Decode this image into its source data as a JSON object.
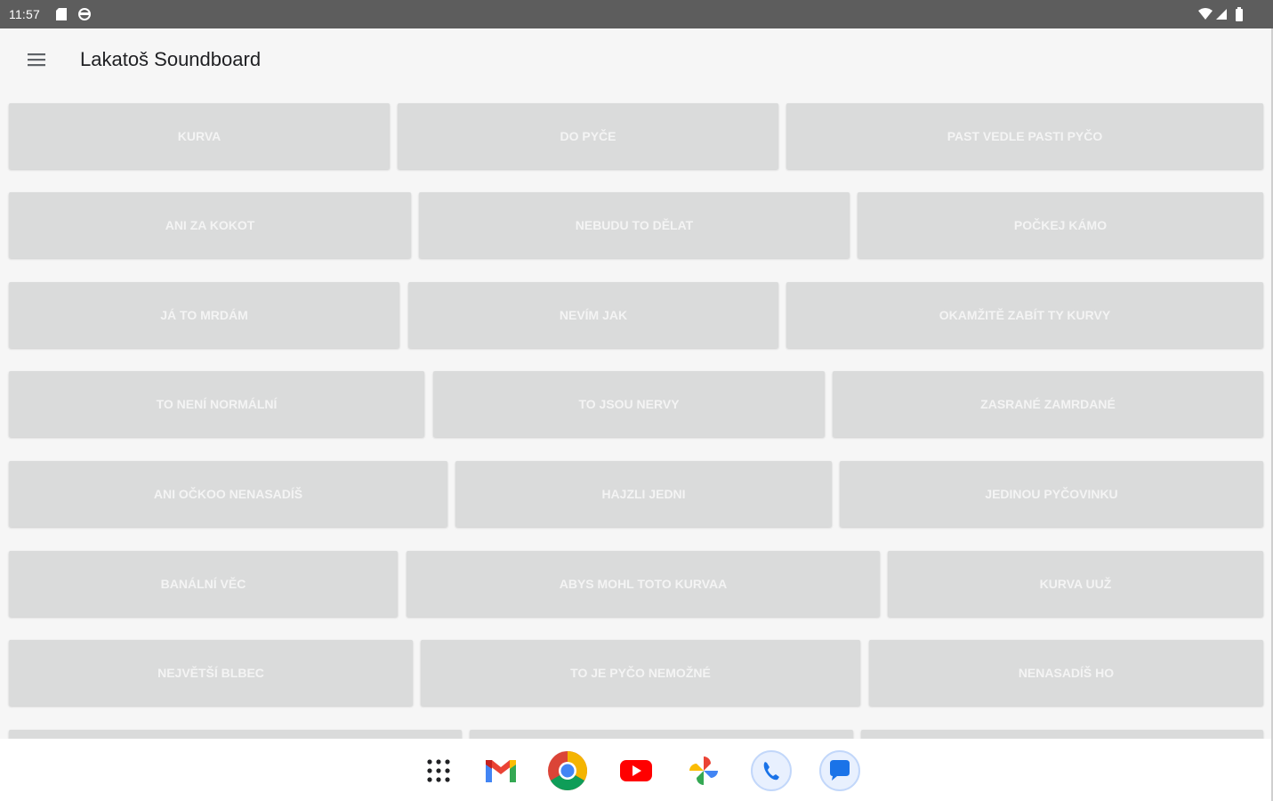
{
  "status_bar": {
    "time": "11:57",
    "left_icons": [
      "sd-card-icon",
      "sync-icon"
    ],
    "right_icons": [
      "wifi-icon",
      "signal-icon",
      "battery-icon"
    ]
  },
  "app_bar": {
    "title": "Lakatoš Soundboard",
    "menu_icon": "menu-icon"
  },
  "sound_rows": [
    [
      "KURVA",
      "DO PYČE",
      "PAST VEDLE PASTI PYČO"
    ],
    [
      "ANI ZA KOKOT",
      "NEBUDU TO DĚLAT",
      "POČKEJ KÁMO"
    ],
    [
      "JÁ TO MRDÁM",
      "NEVÍM JAK",
      "OKAMŽITĚ ZABÍT TY KURVY"
    ],
    [
      "TO NENÍ NORMÁLNÍ",
      "TO JSOU NERVY",
      "ZASRANÉ ZAMRDANÉ"
    ],
    [
      "ANI OČKOO NENASADÍŠ",
      "HAJZLI JEDNI",
      "JEDINOU PYČOVINKU"
    ],
    [
      "BANÁLNÍ VĚC",
      "ABYS MOHL TOTO KURVAA",
      "KURVA UUŽ"
    ],
    [
      "NEJVĚTŠÍ BLBEC",
      "TO JE PYČO NEMOŽNÉ",
      "NENASADÍŠ HO"
    ],
    [
      "",
      "",
      ""
    ]
  ],
  "dock": [
    "apps-grid-icon",
    "gmail-icon",
    "chrome-icon",
    "youtube-icon",
    "photos-icon",
    "phone-icon",
    "messages-icon"
  ],
  "colors": {
    "status_bar": "#5d5d5d",
    "app_bar": "#f6f6f6",
    "button_bg": "#dadbdb",
    "button_text": "#f4f4f4"
  }
}
